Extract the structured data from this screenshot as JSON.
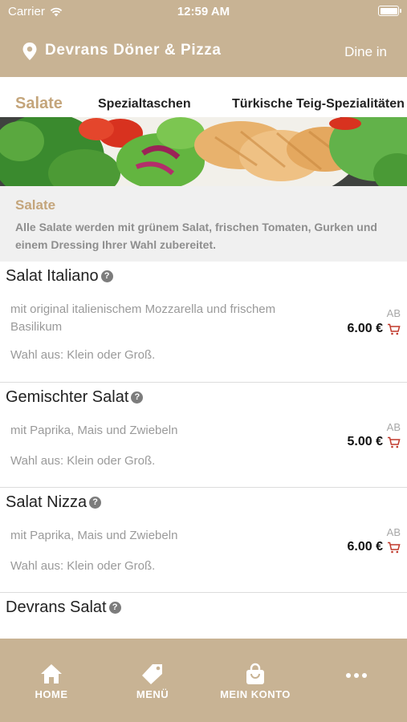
{
  "status_bar": {
    "carrier": "Carrier",
    "time": "12:59 AM"
  },
  "header": {
    "store_name": "Devrans Döner & Pizza",
    "mode": "Dine in"
  },
  "tabs": [
    {
      "label": "Salate",
      "active": true
    },
    {
      "label": "Spezialtaschen",
      "active": false
    },
    {
      "label": "Türkische Teig-Spezialitäten",
      "active": false
    }
  ],
  "category": {
    "title": "Salate",
    "description": "Alle Salate werden mit grünem Salat, frischen Tomaten, Gurken und einem Dressing Ihrer Wahl zubereitet."
  },
  "items": [
    {
      "name": "Salat Italiano",
      "description": "mit original italienischem Mozzarella und frischem Basilikum",
      "choice": "Wahl aus: Klein oder Groß.",
      "price_prefix": "AB",
      "price": "6.00 €"
    },
    {
      "name": "Gemischter Salat",
      "description": "mit Paprika, Mais und Zwiebeln",
      "choice": "Wahl aus: Klein oder Groß.",
      "price_prefix": "AB",
      "price": "5.00 €"
    },
    {
      "name": "Salat Nizza",
      "description": "mit Paprika, Mais und Zwiebeln",
      "choice": "Wahl aus: Klein oder Groß.",
      "price_prefix": "AB",
      "price": "6.00 €"
    },
    {
      "name": "Devrans Salat",
      "description": "",
      "choice": "",
      "price_prefix": "",
      "price": ""
    }
  ],
  "bottom_nav": [
    {
      "label": "HOME",
      "icon": "home-icon"
    },
    {
      "label": "MENÜ",
      "icon": "tag-icon"
    },
    {
      "label": "MEIN KONTO",
      "icon": "shopping-bag-icon"
    },
    {
      "label": "",
      "icon": "more-icon"
    }
  ],
  "colors": {
    "brand": "#c8b394",
    "accent": "#c4a57b",
    "cart": "#c0392b"
  }
}
